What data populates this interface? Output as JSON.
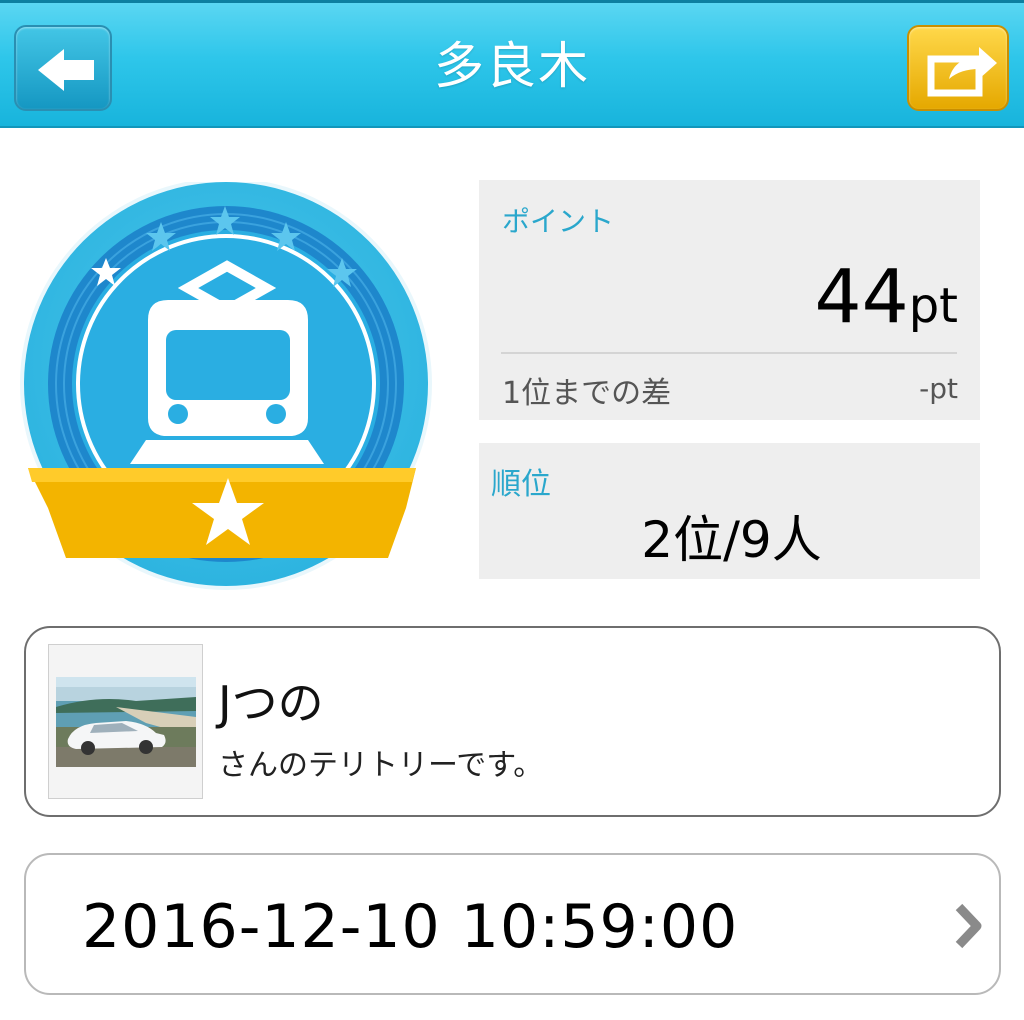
{
  "header": {
    "title": "多良木",
    "back_icon": "arrow-left-icon",
    "share_icon": "share-icon",
    "accent_color": "#2ec6ea",
    "share_color": "#f2bd00"
  },
  "badge": {
    "icon": "train-badge-icon",
    "star_icon": "star-icon"
  },
  "points": {
    "label": "ポイント",
    "value": "44",
    "unit": "pt",
    "diff_label": "1位までの差",
    "diff_value": "-pt"
  },
  "rank": {
    "label": "順位",
    "value": "2位/9人"
  },
  "owner": {
    "name": "Jつの",
    "description": "さんのテリトリーです。"
  },
  "checkin": {
    "datetime": "2016-12-10 10:59:00",
    "chevron_icon": "chevron-right-icon"
  }
}
